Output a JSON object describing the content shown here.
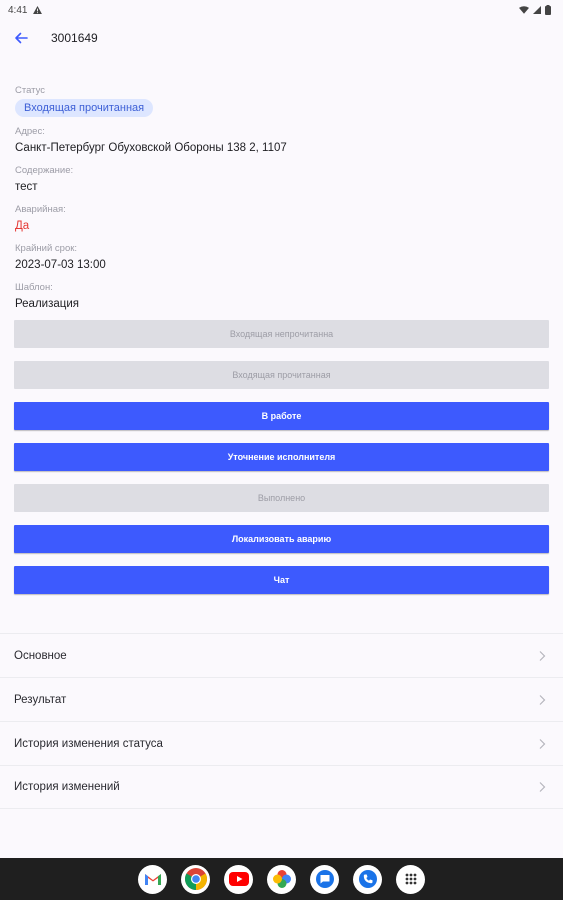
{
  "status_bar": {
    "time": "4:41"
  },
  "app_bar": {
    "title": "3001649"
  },
  "fields": {
    "status": {
      "label": "Статус",
      "value": "Входящая прочитанная"
    },
    "address": {
      "label": "Адрес:",
      "value": "Санкт-Петербург Обуховской Обороны 138 2, 1107"
    },
    "content": {
      "label": "Содержание:",
      "value": "тест"
    },
    "emergency": {
      "label": "Аварийная:",
      "value": "Да"
    },
    "deadline": {
      "label": "Крайний срок:",
      "value": "2023-07-03 13:00"
    },
    "template": {
      "label": "Шаблон:",
      "value": "Реализация"
    }
  },
  "buttons": [
    {
      "label": "Входящая непрочитанна",
      "state": "disabled"
    },
    {
      "label": "Входящая прочитанная",
      "state": "disabled"
    },
    {
      "label": "В работе",
      "state": "active"
    },
    {
      "label": "Уточнение исполнителя",
      "state": "active"
    },
    {
      "label": "Выполнено",
      "state": "disabled"
    },
    {
      "label": "Локализовать аварию",
      "state": "active"
    },
    {
      "label": "Чат",
      "state": "active"
    }
  ],
  "sections": [
    {
      "label": "Основное"
    },
    {
      "label": "Результат"
    },
    {
      "label": "История изменения статуса"
    },
    {
      "label": "История изменений"
    }
  ],
  "dock": [
    {
      "icon": "gmail-icon"
    },
    {
      "icon": "chrome-icon"
    },
    {
      "icon": "youtube-icon"
    },
    {
      "icon": "photos-icon"
    },
    {
      "icon": "messages-icon"
    },
    {
      "icon": "phone-icon"
    },
    {
      "icon": "app-drawer-icon"
    }
  ],
  "colors": {
    "accent": "#3d5afe",
    "danger": "#e53935",
    "badge_bg": "#dde6ff",
    "badge_text": "#3d5fd6"
  }
}
